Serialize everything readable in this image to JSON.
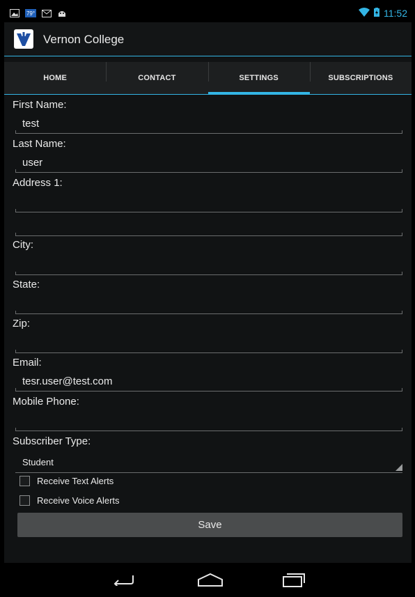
{
  "status_bar": {
    "time": "11:52",
    "notification_icons": [
      "image-icon",
      "calendar-icon",
      "gmail-icon",
      "android-icon"
    ],
    "calendar_text": "79°"
  },
  "action_bar": {
    "title": "Vernon College"
  },
  "tabs": [
    {
      "label": "HOME",
      "active": false
    },
    {
      "label": "CONTACT",
      "active": false
    },
    {
      "label": "SETTINGS",
      "active": true
    },
    {
      "label": "SUBSCRIPTIONS",
      "active": false
    }
  ],
  "form": {
    "first_name": {
      "label": "First Name:",
      "value": "test"
    },
    "last_name": {
      "label": "Last Name:",
      "value": "user"
    },
    "address1": {
      "label": "Address 1:",
      "value": ""
    },
    "address2": {
      "value": ""
    },
    "city": {
      "label": "City:",
      "value": ""
    },
    "state": {
      "label": "State:",
      "value": ""
    },
    "zip": {
      "label": "Zip:",
      "value": ""
    },
    "email": {
      "label": "Email:",
      "value": "tesr.user@test.com"
    },
    "mobile_phone": {
      "label": "Mobile Phone:",
      "value": ""
    },
    "subscriber_type": {
      "label": "Subscriber Type:",
      "value": "Student"
    },
    "text_alerts": {
      "label": "Receive Text Alerts",
      "checked": false
    },
    "voice_alerts": {
      "label": "Receive Voice Alerts",
      "checked": false
    },
    "save_label": "Save"
  },
  "colors": {
    "accent": "#33b5e5",
    "background": "#111314",
    "button": "#4a4c4d"
  }
}
